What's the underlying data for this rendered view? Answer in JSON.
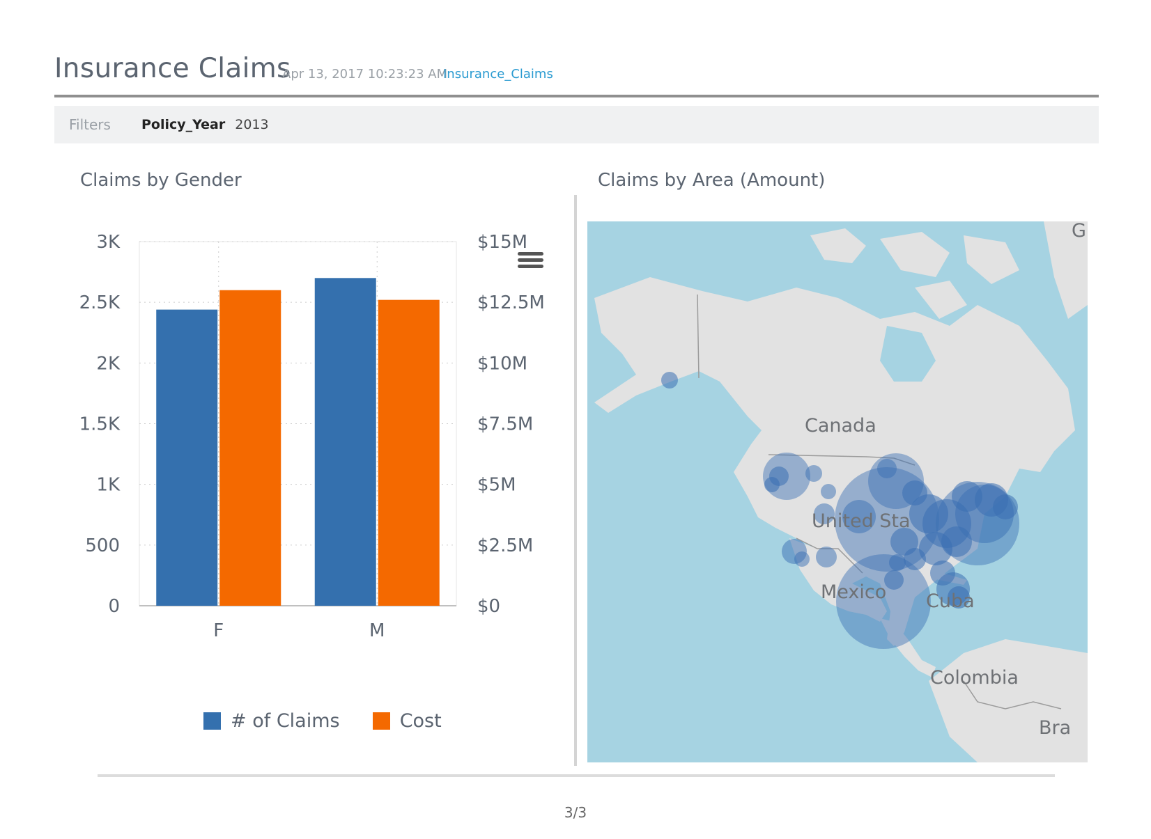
{
  "header": {
    "title": "Insurance Claims",
    "timestamp": "Apr 13, 2017 10:23:23 AM",
    "source_link": "Insurance_Claims"
  },
  "filters": {
    "label": "Filters",
    "items": [
      {
        "key": "Policy_Year",
        "value": "2013"
      }
    ]
  },
  "gender_panel": {
    "title": "Claims by Gender"
  },
  "area_panel": {
    "title": "Claims by Area (Amount)",
    "map_labels": {
      "canada": "Canada",
      "united_states": "United Sta",
      "mexico": "Mexico",
      "cuba": "Cuba",
      "colombia": "Colombia",
      "brazil": "Bra",
      "greenland": "G"
    },
    "bubble_color": "#3a6fb3"
  },
  "footer": {
    "page": "3/3"
  },
  "chart_data": {
    "type": "bar",
    "categories": [
      "F",
      "M"
    ],
    "series": [
      {
        "name": "# of Claims",
        "axis": "left",
        "color": "#3470ae",
        "values": [
          2440,
          2700
        ]
      },
      {
        "name": "Cost",
        "axis": "right",
        "color": "#f46900",
        "values": [
          13000000,
          12600000
        ]
      }
    ],
    "left_axis": {
      "ticks": [
        "0",
        "500",
        "1K",
        "1.5K",
        "2K",
        "2.5K",
        "3K"
      ],
      "ylim": [
        0,
        3000
      ]
    },
    "right_axis": {
      "ticks": [
        "$0",
        "$2.5M",
        "$5M",
        "$7.5M",
        "$10M",
        "$12.5M",
        "$15M"
      ],
      "ylim": [
        0,
        15000000
      ]
    },
    "grid": true,
    "legend_position": "bottom"
  }
}
